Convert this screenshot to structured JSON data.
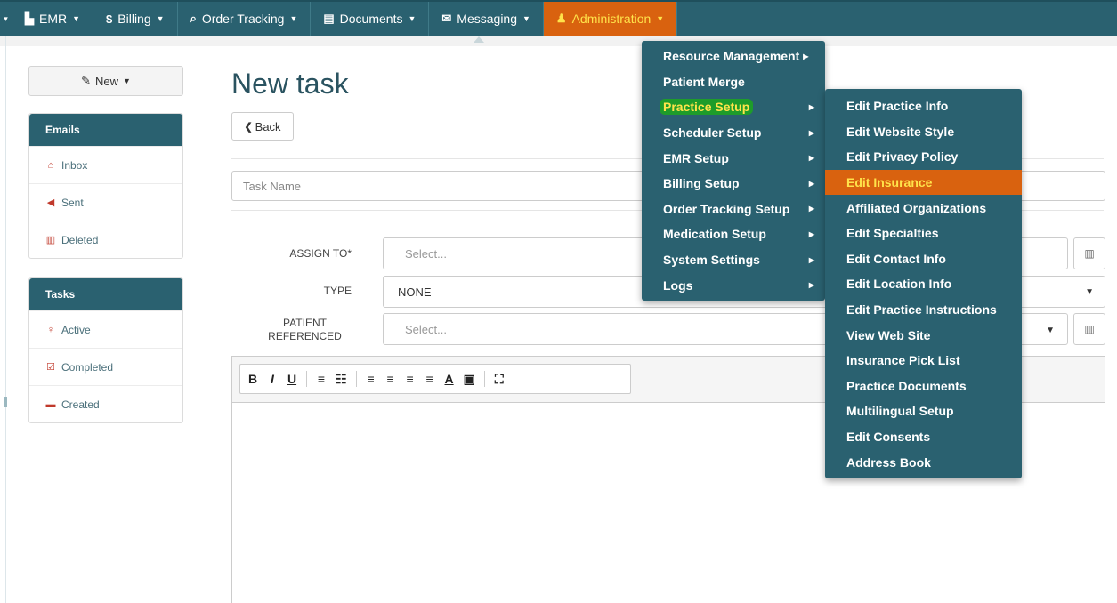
{
  "nav": {
    "items": [
      {
        "icon": "file-icon",
        "glyph": "▙",
        "label": "EMR"
      },
      {
        "icon": "dollar-icon",
        "glyph": "$",
        "label": "Billing"
      },
      {
        "icon": "search-icon",
        "glyph": "⌕",
        "label": "Order Tracking"
      },
      {
        "icon": "document-icon",
        "glyph": "▤",
        "label": "Documents"
      },
      {
        "icon": "envelope-icon",
        "glyph": "✉",
        "label": "Messaging"
      },
      {
        "icon": "user-icon",
        "glyph": "♟",
        "label": "Administration"
      }
    ],
    "active_color": "#d9620f",
    "bar_color": "#2a6170"
  },
  "sidebar": {
    "new_label": "New",
    "emails": {
      "header": "Emails",
      "items": [
        {
          "icon": "inbox-icon",
          "label": "Inbox",
          "color": "#c0392b"
        },
        {
          "icon": "send-icon",
          "label": "Sent",
          "color": "#c0392b"
        },
        {
          "icon": "trash-icon",
          "label": "Deleted",
          "color": "#c0392b"
        }
      ]
    },
    "tasks": {
      "header": "Tasks",
      "items": [
        {
          "icon": "lightbulb-icon",
          "label": "Active",
          "color": "#c0392b"
        },
        {
          "icon": "check-square-icon",
          "label": "Completed",
          "color": "#c0392b"
        },
        {
          "icon": "calendar-icon",
          "label": "Created",
          "color": "#c0392b"
        }
      ]
    }
  },
  "main": {
    "title": "New task",
    "back_label": "Back",
    "task_name_placeholder": "Task Name",
    "assign_to_label": "ASSIGN TO*",
    "assign_to_value": "Select...",
    "type_label": "TYPE",
    "type_value": "NONE",
    "patient_label_1": "PATIENT",
    "patient_label_2": "REFERENCED",
    "patient_value": "Select..."
  },
  "editor": {
    "toolbar": [
      "B",
      "I",
      "U",
      "≡",
      "☷",
      "≡",
      "≡",
      "≡",
      "≡",
      "A",
      "▣",
      "⛶"
    ]
  },
  "admin_menu": {
    "items": [
      {
        "label": "Resource Management",
        "has_sub": true
      },
      {
        "label": "Patient Merge",
        "has_sub": false
      },
      {
        "label": "Practice Setup",
        "has_sub": true,
        "highlighted": true
      },
      {
        "label": "Scheduler Setup",
        "has_sub": true
      },
      {
        "label": "EMR Setup",
        "has_sub": true
      },
      {
        "label": "Billing Setup",
        "has_sub": true
      },
      {
        "label": "Order Tracking Setup",
        "has_sub": true
      },
      {
        "label": "Medication Setup",
        "has_sub": true
      },
      {
        "label": "System Settings",
        "has_sub": true
      },
      {
        "label": "Logs",
        "has_sub": true
      }
    ]
  },
  "practice_menu": {
    "items": [
      {
        "label": "Edit Practice Info"
      },
      {
        "label": "Edit Website Style"
      },
      {
        "label": "Edit Privacy Policy"
      },
      {
        "label": "Edit Insurance",
        "selected": true
      },
      {
        "label": "Affiliated Organizations"
      },
      {
        "label": "Edit Specialties"
      },
      {
        "label": "Edit Contact Info"
      },
      {
        "label": "Edit Location Info"
      },
      {
        "label": "Edit Practice Instructions"
      },
      {
        "label": "View Web Site"
      },
      {
        "label": "Insurance Pick List"
      },
      {
        "label": "Practice Documents"
      },
      {
        "label": "Multilingual Setup"
      },
      {
        "label": "Edit Consents"
      },
      {
        "label": "Address Book"
      }
    ]
  }
}
